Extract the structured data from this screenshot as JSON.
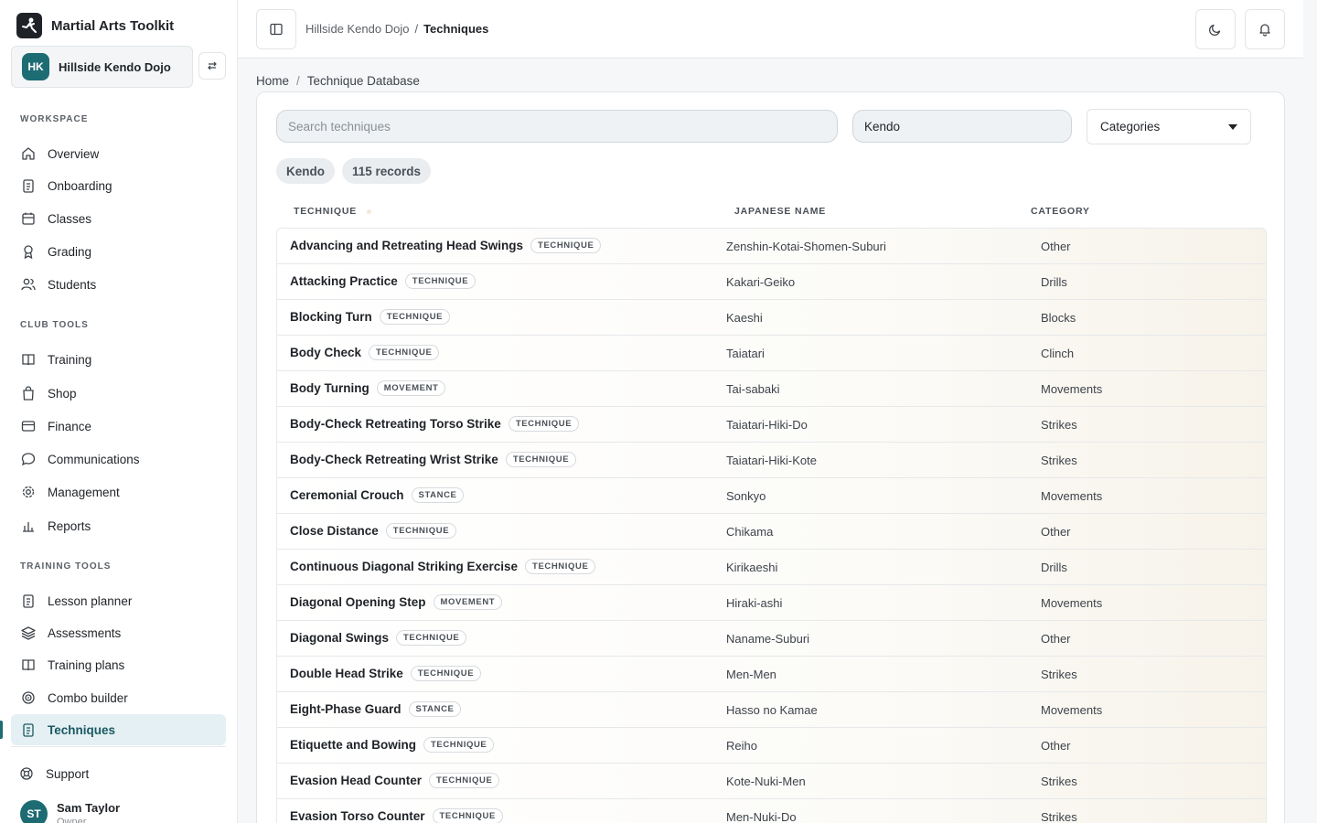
{
  "app": {
    "title": "Martial Arts Toolkit"
  },
  "club": {
    "initials": "HK",
    "name": "Hillside Kendo Dojo"
  },
  "nav": {
    "workspace_heading": "WORKSPACE",
    "workspace": [
      "Overview",
      "Onboarding",
      "Classes",
      "Grading",
      "Students"
    ],
    "club_tools_heading": "CLUB TOOLS",
    "club_tools": [
      "Training",
      "Shop",
      "Finance",
      "Communications",
      "Management",
      "Reports"
    ],
    "training_tools_heading": "TRAINING TOOLS",
    "training_tools": [
      "Lesson planner",
      "Assessments",
      "Training plans",
      "Combo builder",
      "Techniques"
    ],
    "active": "Techniques",
    "support": "Support"
  },
  "user": {
    "initials": "ST",
    "name": "Sam Taylor",
    "role": "Owner"
  },
  "topbar": {
    "crumb_parent": "Hillside Kendo Dojo",
    "crumb_sep": "/",
    "crumb_current": "Techniques"
  },
  "breadcrumb": {
    "home": "Home",
    "sep": "/",
    "current": "Technique Database"
  },
  "filters": {
    "search_placeholder": "Search techniques",
    "style_value": "Kendo",
    "category_label": "Categories"
  },
  "chips": {
    "style": "Kendo",
    "count": "115 records"
  },
  "table": {
    "columns": {
      "technique": "TECHNIQUE",
      "japanese": "JAPANESE NAME",
      "category": "CATEGORY"
    },
    "rows": [
      {
        "name": "Advancing and Retreating Head Swings",
        "type": "TECHNIQUE",
        "japanese": "Zenshin-Kotai-Shomen-Suburi",
        "category": "Other"
      },
      {
        "name": "Attacking Practice",
        "type": "TECHNIQUE",
        "japanese": "Kakari-Geiko",
        "category": "Drills"
      },
      {
        "name": "Blocking Turn",
        "type": "TECHNIQUE",
        "japanese": "Kaeshi",
        "category": "Blocks"
      },
      {
        "name": "Body Check",
        "type": "TECHNIQUE",
        "japanese": "Taiatari",
        "category": "Clinch"
      },
      {
        "name": "Body Turning",
        "type": "MOVEMENT",
        "japanese": "Tai-sabaki",
        "category": "Movements"
      },
      {
        "name": "Body-Check Retreating Torso Strike",
        "type": "TECHNIQUE",
        "japanese": "Taiatari-Hiki-Do",
        "category": "Strikes"
      },
      {
        "name": "Body-Check Retreating Wrist Strike",
        "type": "TECHNIQUE",
        "japanese": "Taiatari-Hiki-Kote",
        "category": "Strikes"
      },
      {
        "name": "Ceremonial Crouch",
        "type": "STANCE",
        "japanese": "Sonkyo",
        "category": "Movements"
      },
      {
        "name": "Close Distance",
        "type": "TECHNIQUE",
        "japanese": "Chikama",
        "category": "Other"
      },
      {
        "name": "Continuous Diagonal Striking Exercise",
        "type": "TECHNIQUE",
        "japanese": "Kirikaeshi",
        "category": "Drills"
      },
      {
        "name": "Diagonal Opening Step",
        "type": "MOVEMENT",
        "japanese": "Hiraki-ashi",
        "category": "Movements"
      },
      {
        "name": "Diagonal Swings",
        "type": "TECHNIQUE",
        "japanese": "Naname-Suburi",
        "category": "Other"
      },
      {
        "name": "Double Head Strike",
        "type": "TECHNIQUE",
        "japanese": "Men-Men",
        "category": "Strikes"
      },
      {
        "name": "Eight-Phase Guard",
        "type": "STANCE",
        "japanese": "Hasso no Kamae",
        "category": "Movements"
      },
      {
        "name": "Etiquette and Bowing",
        "type": "TECHNIQUE",
        "japanese": "Reiho",
        "category": "Other"
      },
      {
        "name": "Evasion Head Counter",
        "type": "TECHNIQUE",
        "japanese": "Kote-Nuki-Men",
        "category": "Strikes"
      },
      {
        "name": "Evasion Torso Counter",
        "type": "TECHNIQUE",
        "japanese": "Men-Nuki-Do",
        "category": "Strikes"
      }
    ]
  },
  "colors": {
    "accent": "#1d6b73",
    "active_bg": "#e4f0f3"
  },
  "icons": [
    "home-icon",
    "clipboard-icon",
    "calendar-icon",
    "medal-icon",
    "users-icon",
    "book-icon",
    "bag-icon",
    "card-icon",
    "chat-icon",
    "gear-icon",
    "bar-chart-icon",
    "layers-icon",
    "target-icon",
    "lifebuoy-icon",
    "moon-icon",
    "bell-icon",
    "panel-icon",
    "swap-icon"
  ]
}
